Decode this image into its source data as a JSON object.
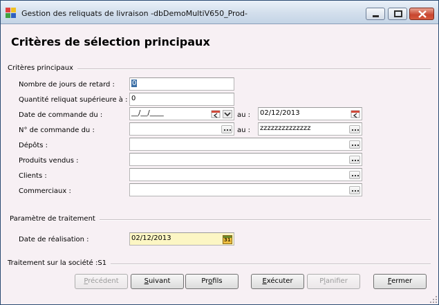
{
  "window": {
    "title": "Gestion des reliquats de livraison -dbDemoMultiV650_Prod-"
  },
  "heading": "Critères de sélection principaux",
  "sections": {
    "principaux": "Critères principaux",
    "traitement": "Paramètre de traitement"
  },
  "fields": {
    "jours_retard": {
      "label": "Nombre de jours de retard :",
      "value": "0"
    },
    "quantite": {
      "label": "Quantité reliquat supérieure à :",
      "value": "0"
    },
    "date_commande": {
      "label": "Date de commande du :",
      "from": "__/__/____",
      "to_label": "au :",
      "to": "02/12/2013"
    },
    "num_commande": {
      "label": "N° de commande du :",
      "from": "",
      "to_label": "au :",
      "to": "zzzzzzzzzzzzzz"
    },
    "depots": {
      "label": "Dépôts :",
      "value": ""
    },
    "produits": {
      "label": "Produits vendus :",
      "value": ""
    },
    "clients": {
      "label": "Clients :",
      "value": ""
    },
    "commerciaux": {
      "label": "Commerciaux :",
      "value": ""
    },
    "date_realisation": {
      "label": "Date de réalisation :",
      "value": "02/12/2013"
    }
  },
  "calendar_icon_text": "31",
  "status": "Traitement sur la société :S1",
  "buttons": {
    "precedent": {
      "pre": "",
      "key": "P",
      "post": "récédent",
      "enabled": false
    },
    "suivant": {
      "pre": "",
      "key": "S",
      "post": "uivant",
      "enabled": true
    },
    "profils": {
      "pre": "Pr",
      "key": "o",
      "post": "fils",
      "enabled": true
    },
    "executer": {
      "pre": "",
      "key": "E",
      "post": "xécuter",
      "enabled": true
    },
    "planifier": {
      "pre": "P",
      "key": "l",
      "post": "anifier",
      "enabled": false
    },
    "fermer": {
      "pre": "",
      "key": "F",
      "post": "ermer",
      "enabled": true
    }
  },
  "colors": {
    "background": "#f7f0f4",
    "accent": "#3a6ea5",
    "date_field": "#fcf6c4",
    "close_button": "#c8452f"
  }
}
